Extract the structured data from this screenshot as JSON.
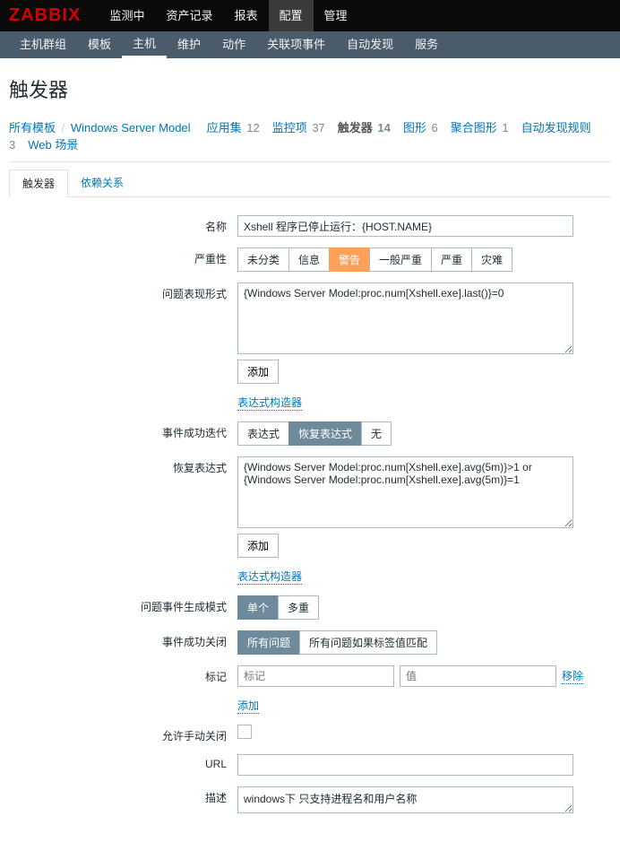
{
  "logo": "ZABBIX",
  "topnav": {
    "items": [
      "监测中",
      "资产记录",
      "报表",
      "配置",
      "管理"
    ],
    "active": 3
  },
  "subnav": {
    "items": [
      "主机群组",
      "模板",
      "主机",
      "维护",
      "动作",
      "关联项事件",
      "自动发现",
      "服务"
    ],
    "active": 2
  },
  "page_title": "触发器",
  "breadcrumbs": {
    "parent": "所有模板",
    "template": "Windows Server Model",
    "items": [
      {
        "label": "应用集",
        "count": "12"
      },
      {
        "label": "监控项",
        "count": "37",
        "link": true
      },
      {
        "label": "触发器",
        "count": "14",
        "active": true
      },
      {
        "label": "图形",
        "count": "6"
      },
      {
        "label": "聚合图形",
        "count": "1"
      },
      {
        "label": "自动发现规则",
        "count": "3"
      },
      {
        "label": "Web 场景",
        "count": ""
      }
    ]
  },
  "tabs": {
    "items": [
      "触发器",
      "依赖关系"
    ],
    "active": 0
  },
  "form": {
    "name": {
      "label": "名称",
      "value": "Xshell 程序已停止运行：{HOST.NAME}"
    },
    "severity": {
      "label": "严重性",
      "options": [
        "未分类",
        "信息",
        "警告",
        "一般严重",
        "严重",
        "灾难"
      ],
      "active": 2
    },
    "expression_form": {
      "label": "问题表现形式",
      "value": "{Windows Server Model:proc.num[Xshell.exe].last()}=0",
      "add": "添加"
    },
    "expr_constructor": "表达式构造器",
    "event_generation": {
      "label": "事件成功迭代",
      "options": [
        "表达式",
        "恢复表达式",
        "无"
      ],
      "active": 1
    },
    "recovery_expression": {
      "label": "恢复表达式",
      "value": "{Windows Server Model:proc.num[Xshell.exe].avg(5m)}>1 or {Windows Server Model:proc.num[Xshell.exe].avg(5m)}=1",
      "add": "添加"
    },
    "recov_constructor": "表达式构造器",
    "problem_event_generation_mode": {
      "label": "问题事件生成模式",
      "options": [
        "单个",
        "多重"
      ],
      "active": 0
    },
    "event_close": {
      "label": "事件成功关闭",
      "options": [
        "所有问题",
        "所有问题如果标签值匹配"
      ],
      "active": 0
    },
    "tags": {
      "label": "标记",
      "tag_placeholder": "标记",
      "value_placeholder": "值",
      "remove": "移除",
      "add": "添加"
    },
    "manual_close": {
      "label": "允许手动关闭"
    },
    "url": {
      "label": "URL",
      "value": ""
    },
    "description": {
      "label": "描述",
      "value": "windows下 只支持进程名和用户名称"
    }
  }
}
